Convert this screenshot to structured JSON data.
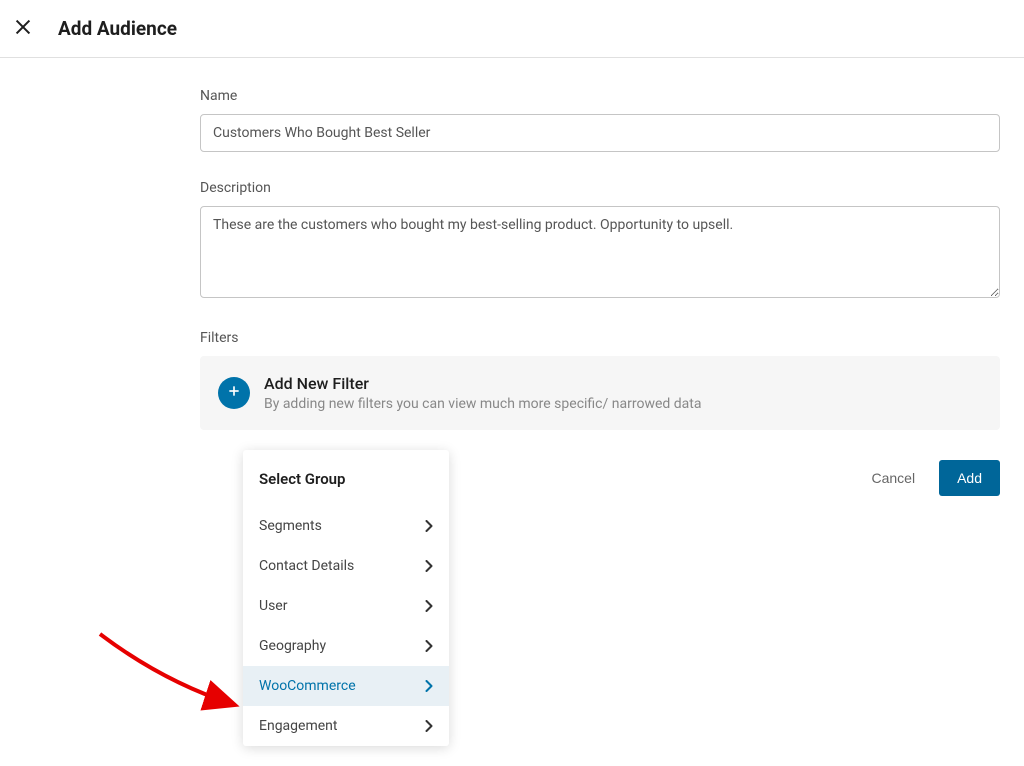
{
  "header": {
    "title": "Add Audience"
  },
  "form": {
    "name_label": "Name",
    "name_value": "Customers Who Bought Best Seller",
    "description_label": "Description",
    "description_value": "These are the customers who bought my best-selling product. Opportunity to upsell.",
    "filters_label": "Filters",
    "add_filter_title": "Add New Filter",
    "add_filter_subtitle": "By adding new filters you can view much more specific/ narrowed data"
  },
  "actions": {
    "cancel_label": "Cancel",
    "add_label": "Add"
  },
  "dropdown": {
    "header": "Select Group",
    "items": [
      {
        "label": "Segments",
        "highlighted": false
      },
      {
        "label": "Contact Details",
        "highlighted": false
      },
      {
        "label": "User",
        "highlighted": false
      },
      {
        "label": "Geography",
        "highlighted": false
      },
      {
        "label": "WooCommerce",
        "highlighted": true
      },
      {
        "label": "Engagement",
        "highlighted": false
      }
    ]
  }
}
